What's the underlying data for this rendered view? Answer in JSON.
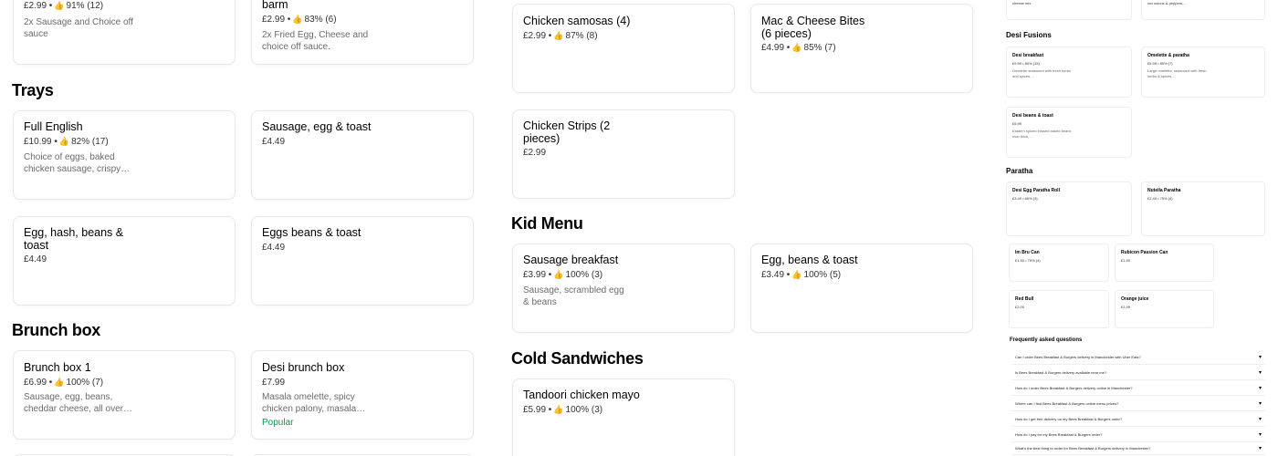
{
  "thumb_icon": "thumbs-up-icon",
  "top_cards": [
    {
      "meta_price": "£2.99 •",
      "meta_rating": "91% (12)",
      "desc": "2x Sausage and Choice off sauce"
    },
    {
      "title": "barm",
      "meta_price": "£2.99 •",
      "meta_rating": "83% (6)",
      "desc": "2x Fried Egg, Cheese and choice off sauce."
    }
  ],
  "sections": {
    "trays": "Trays",
    "brunch_box": "Brunch box",
    "kid_menu": "Kid Menu",
    "cold_sandwiches": "Cold Sandwiches"
  },
  "trays": [
    {
      "title": "Full English",
      "meta_price": "£10.99 •",
      "meta_rating": "82% (17)",
      "desc": "Choice of eggs, baked chicken sausage, crispy…"
    },
    {
      "title": "Sausage, egg & toast",
      "price": "£4.49"
    },
    {
      "title": "Egg, hash, beans & toast",
      "price": "£4.49"
    },
    {
      "title": "Eggs beans & toast",
      "price": "£4.49"
    }
  ],
  "brunch": [
    {
      "title": "Brunch box 1",
      "meta_price": "£6.99 •",
      "meta_rating": "100% (7)",
      "desc": "Sausage, egg, beans, cheddar cheese, all over…"
    },
    {
      "title": "Desi brunch box",
      "price": "£7.99",
      "desc": "Masala omelette, spicy chicken palony, masala…",
      "badge": "Popular"
    }
  ],
  "middle": [
    {
      "title": "Chicken samosas (4)",
      "meta_price": "£2.99 •",
      "meta_rating": "87% (8)"
    },
    {
      "title": "Mac & Cheese Bites (6 pieces)",
      "meta_price": "£4.99 •",
      "meta_rating": "85% (7)"
    },
    {
      "title": "Chicken Strips (2 pieces)",
      "price": "£2.99"
    }
  ],
  "kids": [
    {
      "title": "Sausage breakfast",
      "meta_price": "£3.99 •",
      "meta_rating": "100% (3)",
      "desc": "Sausage, scrambled egg & beans"
    },
    {
      "title": "Egg, beans & toast",
      "meta_price": "£3.49 •",
      "meta_rating": "100% (5)"
    }
  ],
  "cold": [
    {
      "title": "Tandoori chicken mayo",
      "meta_price": "£5.99 •",
      "meta_rating": "100% (3)"
    }
  ],
  "mini": {
    "top_left_desc": "cheese mix.",
    "top_right_desc": "red onions & peppers,…",
    "desi_fusions": "Desi Fusions",
    "fusions": [
      {
        "t": "Desi breakfast",
        "m": "£9.99 • 80% (15)",
        "d": "Omelette seasoned with fresh herbs and spices,…"
      },
      {
        "t": "Omelette & paratha",
        "m": "£5.99 • 85% (7)",
        "d": "Large omelette, seasoned with fresh herbs & spices,…"
      },
      {
        "t": "Desi beans & toast",
        "m": "£5.99",
        "d": "Eastern spiced infused baked beans over thick…"
      }
    ],
    "paratha": "Paratha",
    "parathas": [
      {
        "t": "Desi Egg Paratha Roll",
        "m": "£3.49 • 66% (3)"
      },
      {
        "t": "Nutella Paratha",
        "m": "£2.49 • 75% (4)"
      }
    ],
    "drinks": [
      {
        "t": "Im Bru Can",
        "m": "£1.50 • 75% (4)"
      },
      {
        "t": "Rubicon Passion Can",
        "m": "£1.50"
      },
      {
        "t": "Red Bull",
        "m": "£2.00"
      },
      {
        "t": "Orange juice",
        "m": "£2.49"
      }
    ],
    "faq_title": "Frequently asked questions",
    "faqs": [
      "Can I order Bees Breakfast & Burgers delivery in Manchester with Uber Eats?",
      "Is Bees Breakfast & Burgers delivery available near me?",
      "How do I order Bees Breakfast & Burgers delivery online in Manchester?",
      "Where can I find Bees Breakfast & Burgers online menu prices?",
      "How do I get free delivery on my Bees Breakfast & Burgers order?",
      "How do I pay for my Bees Breakfast & Burgers order?",
      "What's the best thing to order for Bees Breakfast & Burgers delivery in Manchester?"
    ]
  }
}
